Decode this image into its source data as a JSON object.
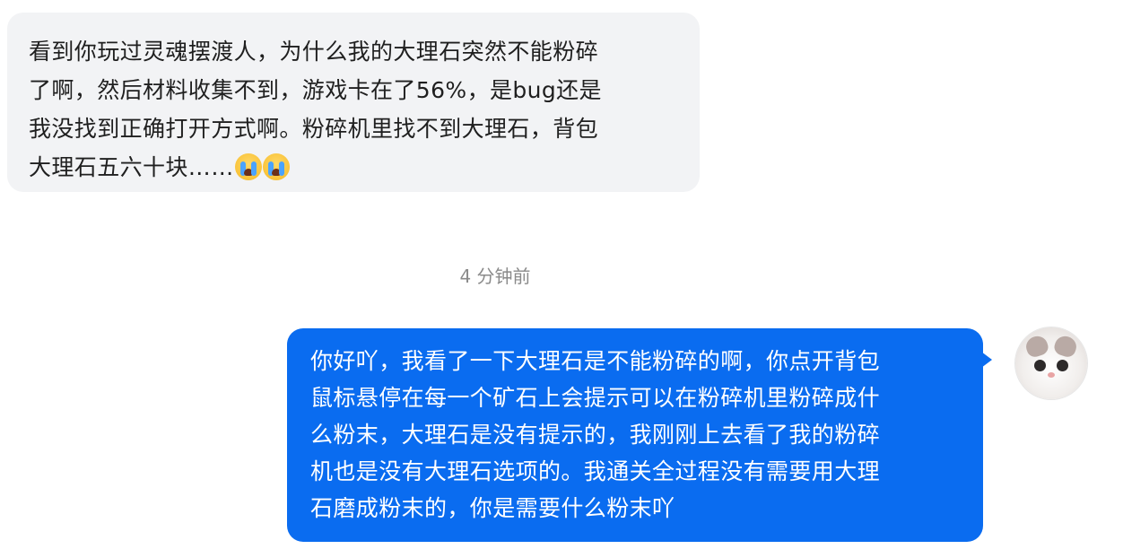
{
  "conversation": {
    "incoming": {
      "lines": [
        "看到你玩过灵魂摆渡人，为什么我的大理石突然不能粉碎",
        "了啊，然后材料收集不到，游戏卡在了56%，是bug还是",
        "我没找到正确打开方式啊。粉碎机里找不到大理石，背包",
        "大理石五六十块……"
      ],
      "emoji": [
        "loudly-crying-face-emoji",
        "loudly-crying-face-emoji"
      ]
    },
    "timestamp": "4 分钟前",
    "outgoing": {
      "lines": [
        "你好吖，我看了一下大理石是不能粉碎的啊，你点开背包",
        "鼠标悬停在每一个矿石上会提示可以在粉碎机里粉碎成什",
        "么粉末，大理石是没有提示的，我刚刚上去看了我的粉碎",
        "机也是没有大理石选项的。我通关全过程没有需要用大理",
        "石磨成粉末的，你是需要什么粉末吖"
      ],
      "bubble_color": "#0a6cf0",
      "text_color": "#ffffff"
    },
    "avatar_icon": "cat-avatar"
  }
}
